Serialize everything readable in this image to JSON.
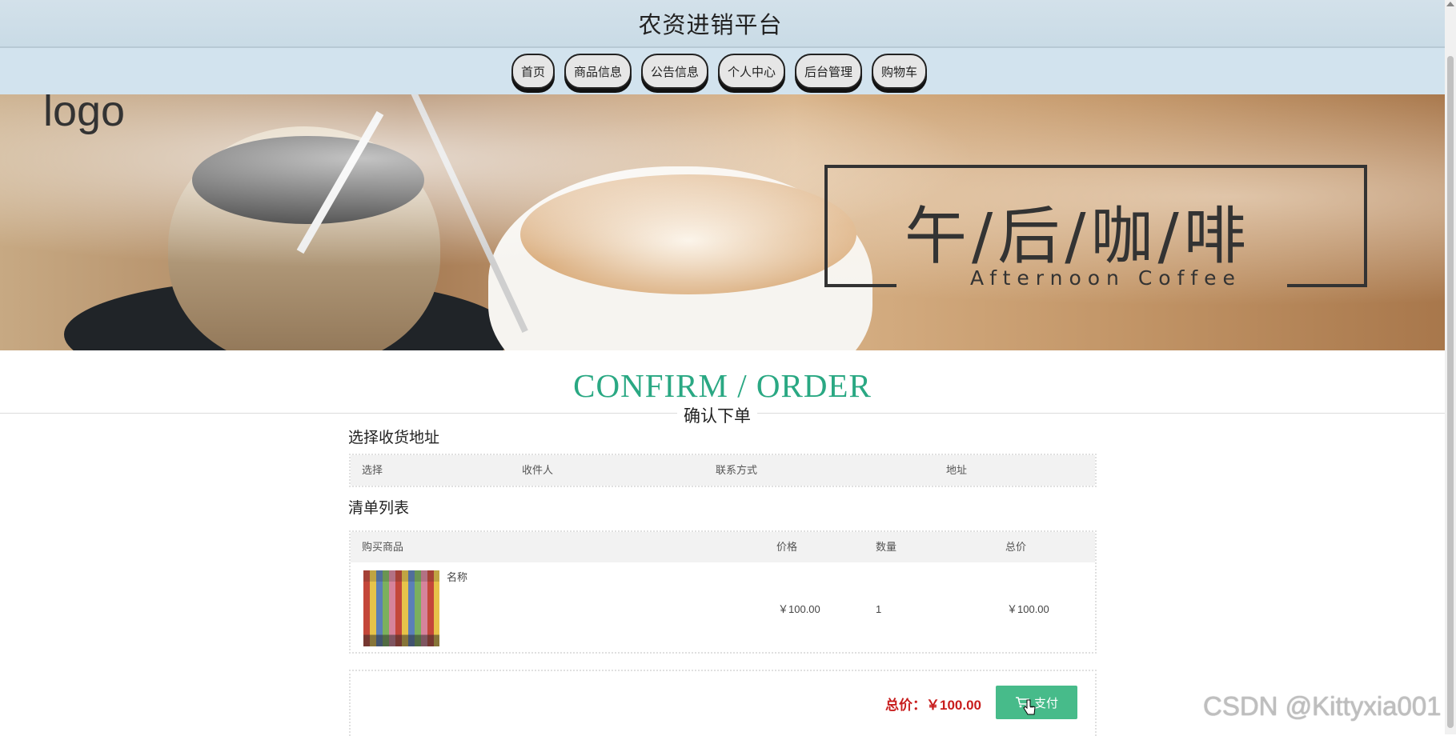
{
  "header": {
    "site_title": "农资进销平台"
  },
  "nav": {
    "items": [
      {
        "label": "首页"
      },
      {
        "label": "商品信息"
      },
      {
        "label": "公告信息"
      },
      {
        "label": "个人中心"
      },
      {
        "label": "后台管理"
      },
      {
        "label": "购物车"
      }
    ]
  },
  "banner": {
    "logo": "logo",
    "title_cn": "午/后/咖/啡",
    "title_en": "Afternoon Coffee"
  },
  "page_heading": {
    "en": "CONFIRM / ORDER",
    "cn": "确认下单"
  },
  "address_section": {
    "title": "选择收货地址",
    "columns": [
      "选择",
      "收件人",
      "联系方式",
      "地址"
    ]
  },
  "cart_section": {
    "title": "清单列表",
    "columns": [
      "购买商品",
      "价格",
      "数量",
      "总价"
    ],
    "rows": [
      {
        "name": "名称",
        "price": "￥100.00",
        "quantity": "1",
        "total": "￥100.00"
      }
    ]
  },
  "summary": {
    "total_label": "总价：￥100.00",
    "pay_label": "支付"
  },
  "watermark": "CSDN @Kittyxia001",
  "colors": {
    "accent_green": "#2aa883",
    "button_green": "#47bb8a",
    "price_red": "#c81d1d",
    "header_bg": "#d2e3ee"
  },
  "icons": {
    "pay_button_icon": "cart-icon"
  }
}
